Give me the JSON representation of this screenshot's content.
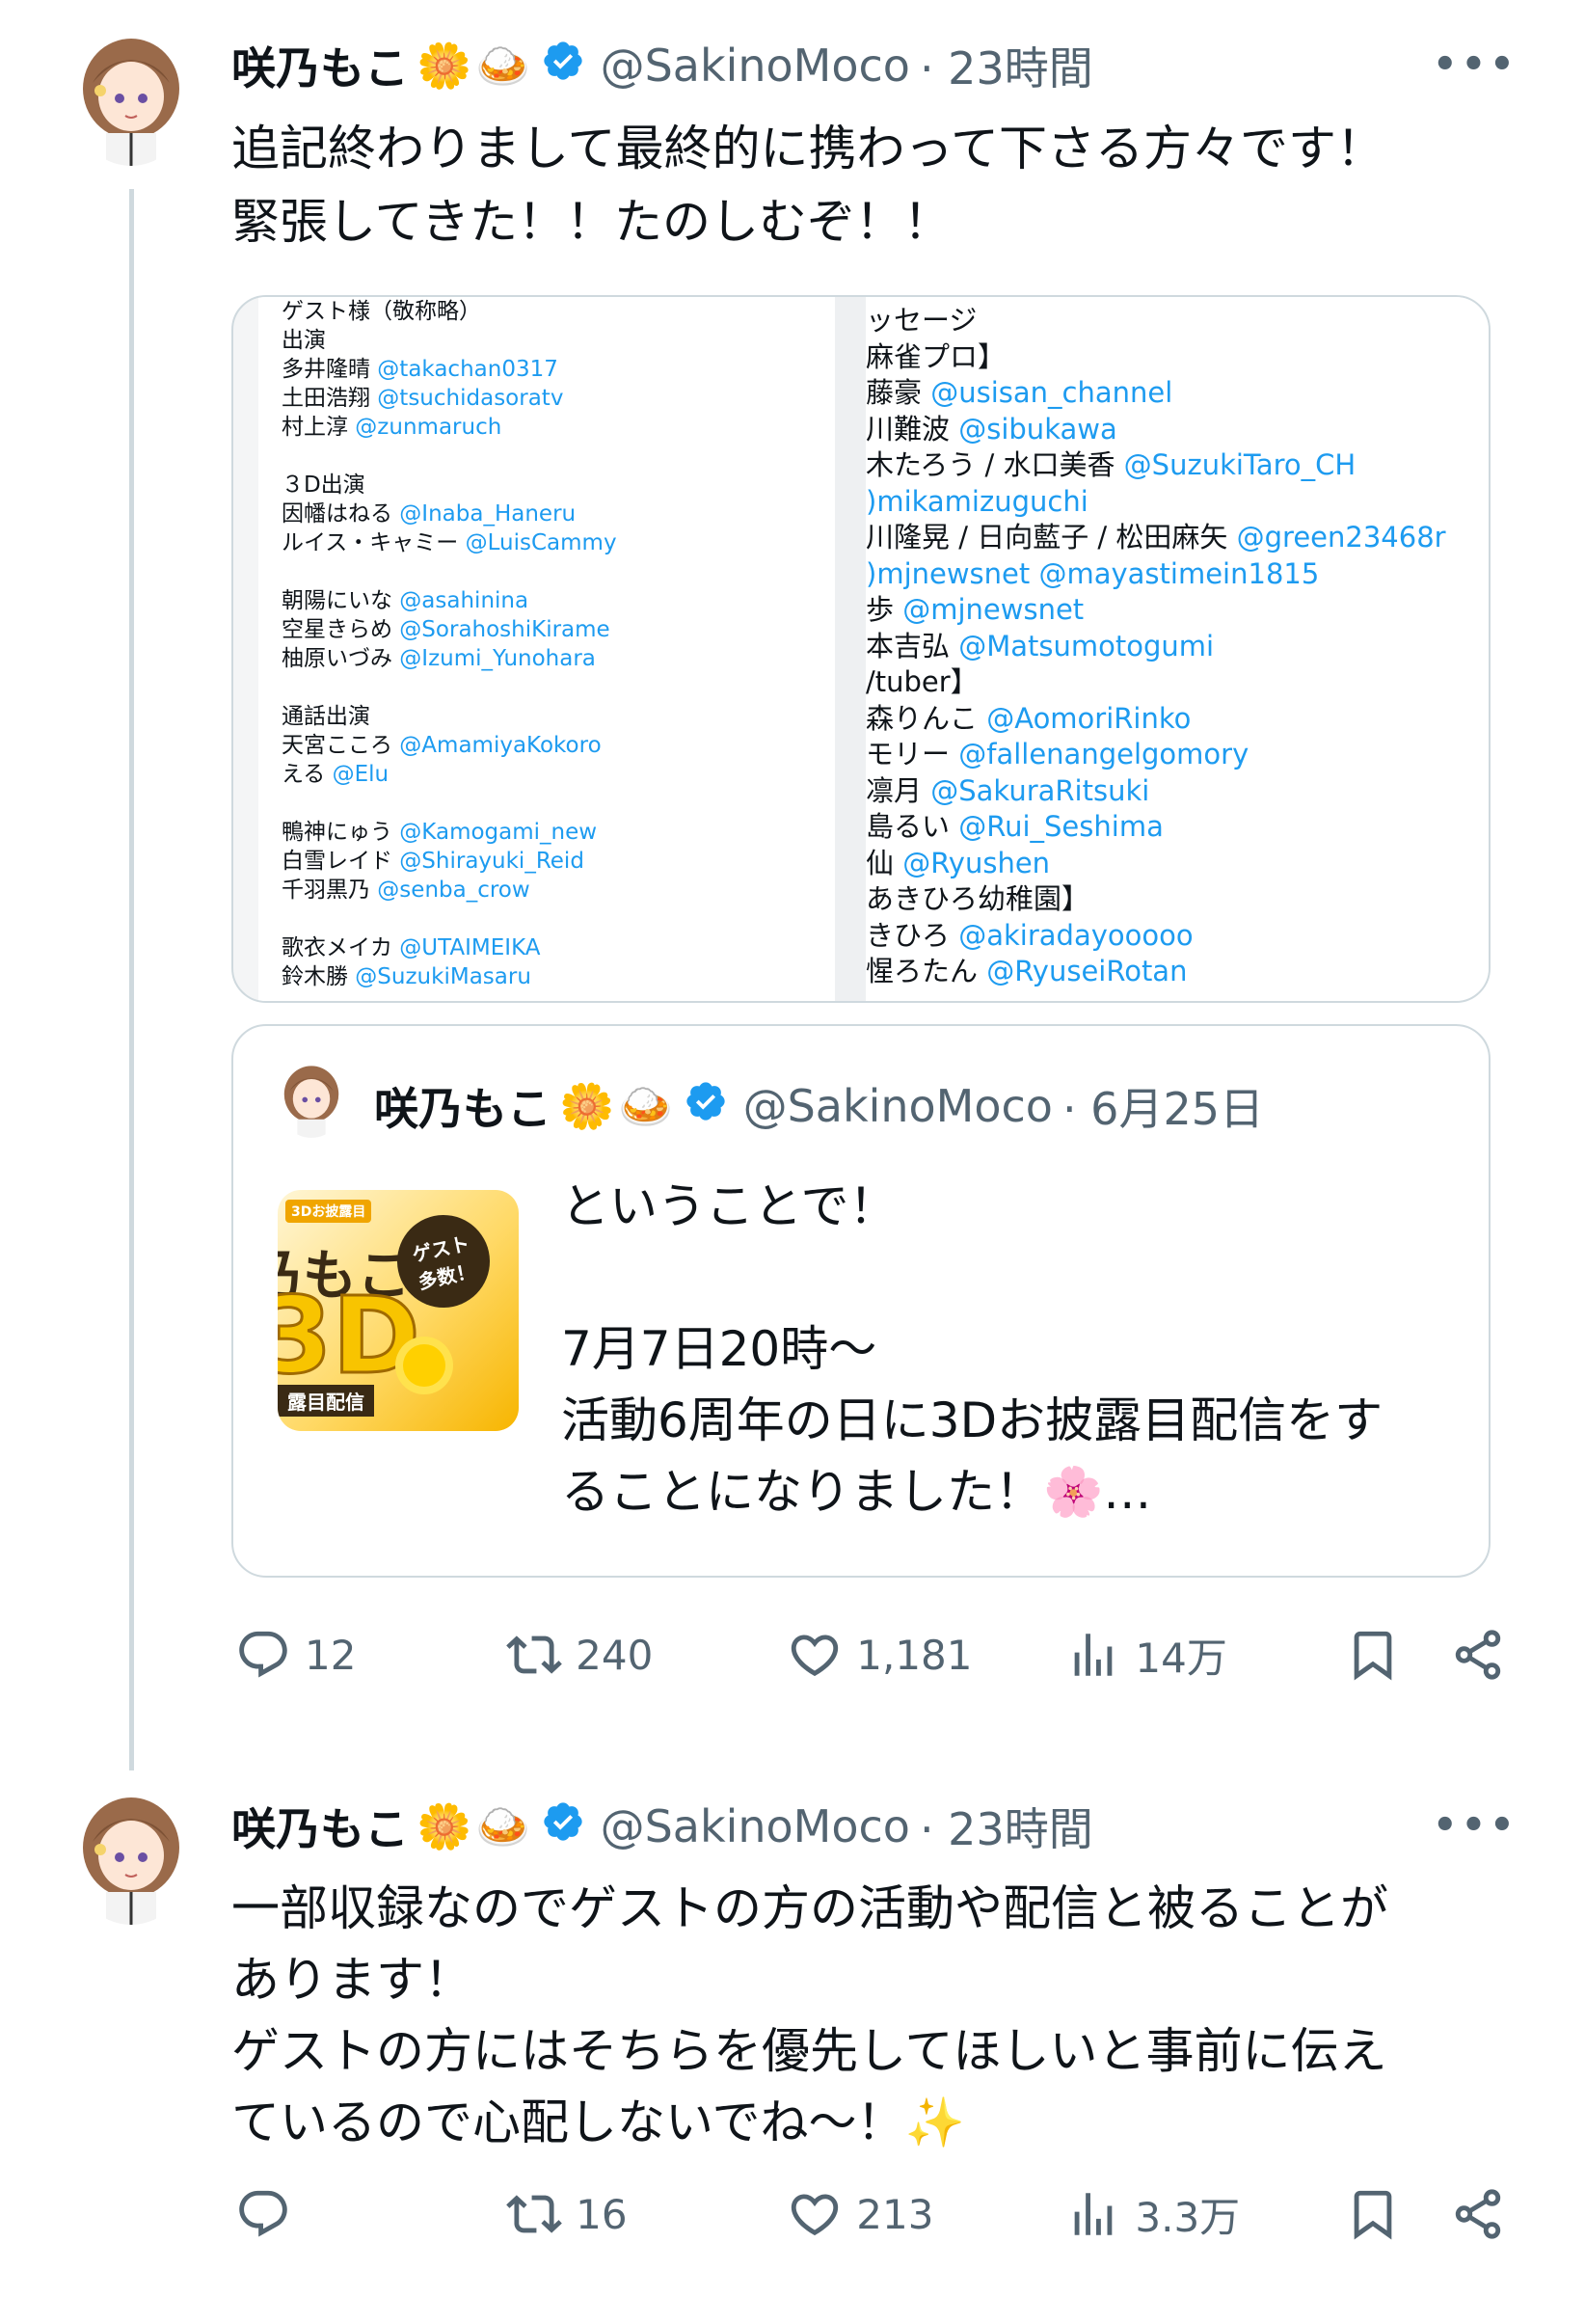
{
  "tweets": [
    {
      "name": "咲乃もこ",
      "emojis": [
        "🌼",
        "🍛"
      ],
      "handle": "@SakinoMoco",
      "time": "· 23時間",
      "text": "追記終わりまして最終的に携わって下さる方々です！\n緊張してきた！！たのしむぞ！！",
      "counts": {
        "reply": "12",
        "retweet": "240",
        "like": "1,181",
        "views": "14万"
      }
    },
    {
      "name": "咲乃もこ",
      "emojis": [
        "🌼",
        "🍛"
      ],
      "handle": "@SakinoMoco",
      "time": "· 23時間",
      "text": "一部収録なのでゲストの方の活動や配信と被ることが\nあります！\nゲストの方にはそちらを優先してほしいと事前に伝え\nているので心配しないでね〜！✨",
      "counts": {
        "reply": "",
        "retweet": "16",
        "like": "213",
        "views": "3.3万"
      }
    }
  ],
  "guest_list_left": [
    [
      "ゲスト様（敬称略）",
      ""
    ],
    [
      "出演",
      ""
    ],
    [
      "多井隆晴",
      "@takachan0317"
    ],
    [
      "土田浩翔",
      "@tsuchidasoratv"
    ],
    [
      "村上淳",
      "@zunmaruch"
    ],
    [
      "",
      ""
    ],
    [
      "３D出演",
      ""
    ],
    [
      "因幡はねる",
      "@Inaba_Haneru"
    ],
    [
      "ルイス・キャミー",
      "@LuisCammy"
    ],
    [
      "",
      ""
    ],
    [
      "朝陽にいな",
      "@asahinina"
    ],
    [
      "空星きらめ",
      "@SorahoshiKirame"
    ],
    [
      "柚原いづみ",
      "@Izumi_Yunohara"
    ],
    [
      "",
      ""
    ],
    [
      "通話出演",
      ""
    ],
    [
      "天宮こころ",
      "@AmamiyaKokoro"
    ],
    [
      "える",
      "@Elu"
    ],
    [
      "",
      ""
    ],
    [
      "鴨神にゅう",
      "@Kamogami_new"
    ],
    [
      "白雪レイド",
      "@Shirayuki_Reid"
    ],
    [
      "千羽黒乃",
      "@senba_crow"
    ],
    [
      "",
      ""
    ],
    [
      "歌衣メイカ",
      "@UTAIMEIKA"
    ],
    [
      "鈴木勝",
      "@SuzukiMasaru"
    ]
  ],
  "guest_list_right": [
    [
      "ッセージ",
      ""
    ],
    [
      "麻雀プロ】",
      ""
    ],
    [
      "藤豪",
      "@usisan_channel"
    ],
    [
      "川難波",
      "@sibukawa"
    ],
    [
      "木たろう / 水口美香",
      "@SuzukiTaro_CH"
    ],
    [
      "",
      ")mikamizuguchi"
    ],
    [
      "川隆晃 / 日向藍子 / 松田麻矢",
      "@green23468r"
    ],
    [
      "",
      ")mjnewsnet @mayastimein1815"
    ],
    [
      "歩",
      "@mjnewsnet"
    ],
    [
      "本吉弘",
      "@Matsumotogumi"
    ],
    [
      "/tuber】",
      ""
    ],
    [
      "森りんこ",
      "@AomoriRinko"
    ],
    [
      "モリー",
      "@fallenangelgomory"
    ],
    [
      "凛月",
      "@SakuraRitsuki"
    ],
    [
      "島るい",
      "@Rui_Seshima"
    ],
    [
      "仙",
      "@Ryushen"
    ],
    [
      "あきひろ幼稚園】",
      ""
    ],
    [
      "きひろ",
      "@akiradayooooo"
    ],
    [
      "惺ろたん",
      "@RyuseiRotan"
    ]
  ],
  "quote": {
    "name": "咲乃もこ",
    "emojis": [
      "🌼",
      "🍛"
    ],
    "handle": "@SakinoMoco",
    "time": "· 6月25日",
    "text": "ということで！\n\n7月7日20時〜\n活動6周年の日に3Dお披露目配信をす\nることになりました！🌸…",
    "thumb_label_top": "3Dお披露目",
    "thumb_label_main": "乃もこ",
    "thumb_label_big": "3D",
    "thumb_bubble": "ゲスト\n多数！",
    "thumb_strip": "露目配信"
  },
  "icons": {
    "more": "more-icon",
    "verified": "verified-badge-icon",
    "reply": "reply-icon",
    "retweet": "retweet-icon",
    "like": "like-icon",
    "views": "views-icon",
    "bookmark": "bookmark-icon",
    "share": "share-icon"
  },
  "colors": {
    "accent": "#1d9bf0",
    "muted": "#536471",
    "text": "#0f1419",
    "border": "#cfd9de"
  }
}
